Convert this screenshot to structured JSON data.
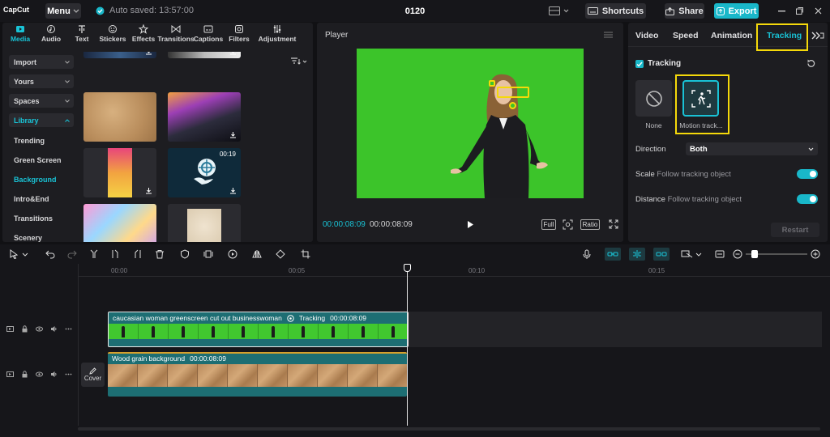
{
  "app": {
    "logo": "CapCut",
    "menu_label": "Menu",
    "autosave": "Auto saved: 13:57:00",
    "project_title": "0120",
    "shortcuts_label": "Shortcuts",
    "share_label": "Share",
    "export_label": "Export"
  },
  "media_panel": {
    "tabs": [
      {
        "label": "Media",
        "icon": "media-icon"
      },
      {
        "label": "Audio",
        "icon": "audio-icon"
      },
      {
        "label": "Text",
        "icon": "text-icon"
      },
      {
        "label": "Stickers",
        "icon": "stickers-icon"
      },
      {
        "label": "Effects",
        "icon": "effects-icon"
      },
      {
        "label": "Transitions",
        "icon": "transitions-icon"
      },
      {
        "label": "Captions",
        "icon": "captions-icon"
      },
      {
        "label": "Filters",
        "icon": "filters-icon"
      },
      {
        "label": "Adjustment",
        "icon": "adjustment-icon"
      }
    ],
    "sidebar": [
      {
        "label": "Import"
      },
      {
        "label": "Yours"
      },
      {
        "label": "Spaces"
      },
      {
        "label": "Library"
      },
      {
        "label": "Trending"
      },
      {
        "label": "Green Screen"
      },
      {
        "label": "Background"
      },
      {
        "label": "Intro&End"
      },
      {
        "label": "Transitions"
      },
      {
        "label": "Scenery"
      }
    ],
    "thumb_duration": "00:19"
  },
  "player": {
    "title": "Player",
    "current_time": "00:00:08:09",
    "total_time": "00:00:08:09",
    "full_label": "Full",
    "ratio_label": "Ratio"
  },
  "properties": {
    "tabs": [
      "Video",
      "Speed",
      "Animation",
      "Tracking"
    ],
    "active_tab": "Tracking",
    "tracking_label": "Tracking",
    "options": [
      {
        "label": "None",
        "icon": "none-icon"
      },
      {
        "label": "Motion track...",
        "icon": "motion-track-icon"
      }
    ],
    "direction_label": "Direction",
    "direction_value": "Both",
    "scale_label": "Scale",
    "scale_sub": "Follow tracking object",
    "distance_label": "Distance",
    "distance_sub": "Follow tracking object",
    "restart_label": "Restart"
  },
  "timeline": {
    "ruler": [
      "00:00",
      "00:05",
      "00:10",
      "00:15"
    ],
    "main_clip": {
      "title": "caucasian woman greenscreen cut out businesswoman",
      "tag": "Tracking",
      "duration": "00:00:08:09"
    },
    "bg_clip": {
      "title": "Wood grain background",
      "duration": "00:00:08:09"
    },
    "cover_label": "Cover"
  },
  "colors": {
    "accent": "#19c3d6",
    "highlight": "#f5d90a",
    "greenscreen": "#3cc42a",
    "clip": "#1d6e73"
  }
}
